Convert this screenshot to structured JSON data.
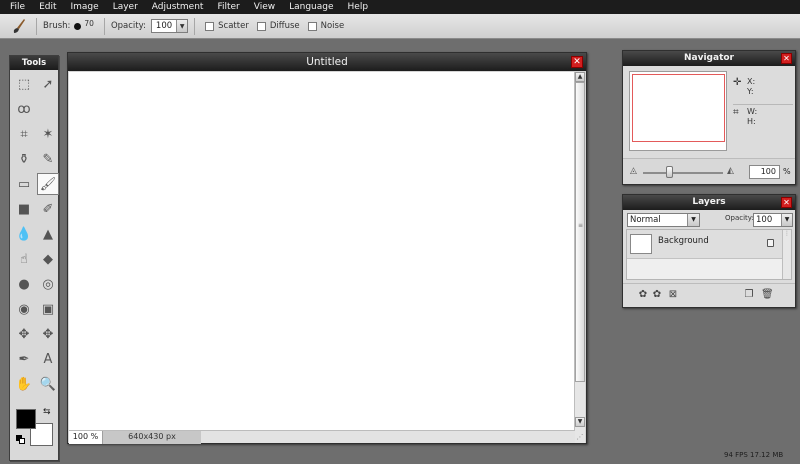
{
  "menu": [
    "File",
    "Edit",
    "Image",
    "Layer",
    "Adjustment",
    "Filter",
    "View",
    "Language",
    "Help"
  ],
  "toolbar": {
    "brush_label": "Brush:",
    "brush_size": "70",
    "opacity_label": "Opacity:",
    "opacity_value": "100",
    "scatter_label": "Scatter",
    "diffuse_label": "Diffuse",
    "noise_label": "Noise"
  },
  "tools_panel": {
    "title": "Tools",
    "items": [
      {
        "name": "marquee-select-icon",
        "glyph": "⬚"
      },
      {
        "name": "move-tool-icon",
        "glyph": "➚"
      },
      {
        "name": "lasso-icon",
        "glyph": "ꝏ"
      },
      {
        "name": "blank-tool",
        "glyph": ""
      },
      {
        "name": "crop-icon",
        "glyph": "⌗"
      },
      {
        "name": "magic-wand-icon",
        "glyph": "✶"
      },
      {
        "name": "clone-stamp-icon",
        "glyph": "⚱"
      },
      {
        "name": "pencil-icon",
        "glyph": "✎"
      },
      {
        "name": "eraser-icon",
        "glyph": "▭"
      },
      {
        "name": "brush-icon",
        "glyph": "🖌"
      },
      {
        "name": "rectangle-shape-icon",
        "glyph": "■"
      },
      {
        "name": "color-replace-icon",
        "glyph": "✐"
      },
      {
        "name": "blur-drop-icon",
        "glyph": "💧"
      },
      {
        "name": "sharpen-icon",
        "glyph": "▲"
      },
      {
        "name": "smudge-icon",
        "glyph": "☝"
      },
      {
        "name": "sponge-icon",
        "glyph": "◆"
      },
      {
        "name": "burn-icon",
        "glyph": "●"
      },
      {
        "name": "dodge-icon",
        "glyph": "◎"
      },
      {
        "name": "red-eye-icon",
        "glyph": "◉"
      },
      {
        "name": "gradient-icon",
        "glyph": "▣"
      },
      {
        "name": "spot-heal-icon",
        "glyph": "✥"
      },
      {
        "name": "bloat-icon",
        "glyph": "✥"
      },
      {
        "name": "color-picker-icon",
        "glyph": "✒"
      },
      {
        "name": "text-tool-icon",
        "glyph": "A"
      },
      {
        "name": "hand-tool-icon",
        "glyph": "✋"
      },
      {
        "name": "zoom-tool-icon",
        "glyph": "🔍"
      }
    ]
  },
  "document": {
    "title": "Untitled",
    "zoom": "100 %",
    "size": "640x430 px"
  },
  "navigator": {
    "title": "Navigator",
    "x_label": "X:",
    "y_label": "Y:",
    "w_label": "W:",
    "h_label": "H:",
    "zoom_value": "100",
    "zoom_unit": "%"
  },
  "layers": {
    "title": "Layers",
    "blend_mode": "Normal",
    "opacity_label": "Opacity:",
    "opacity_value": "100",
    "items": [
      {
        "name": "Background"
      }
    ]
  },
  "status": {
    "perf": "94 FPS 17.12 MB"
  },
  "colors": {
    "foreground": "#000000",
    "background": "#ffffff",
    "accent_close": "#d21f1f"
  }
}
